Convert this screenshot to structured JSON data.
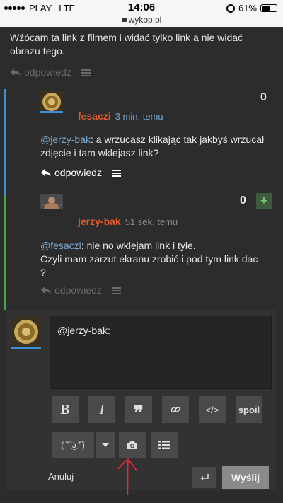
{
  "statusbar": {
    "carrier": "PLAY",
    "network": "LTE",
    "time": "14:06",
    "url": "wykop.pl",
    "battery": "61%"
  },
  "thread": {
    "top_text": "Wźócam ta link z filmem i widać tylko link a nie widać obrazu tego.",
    "top_reply_label": "odpowiedz"
  },
  "comments": [
    {
      "author": "fesaczi",
      "time": "3 min. temu",
      "score": "0",
      "mention": "@jerzy-bak",
      "text": ": a wrzucasz klikając tak jakbyś wrzucał zdjęcie i tam wklejasz link?",
      "reply_label": "odpowiedz",
      "bar_color": "#3b8fd8"
    },
    {
      "author": "jerzy-bak",
      "time": "51 sek. temu",
      "score": "0",
      "plus": "+",
      "mention": "@fesaczi",
      "text_line1": ": nie no wklejam link i tyle.",
      "text_line2": "Czyli mam zarzut ekranu zrobić i pod tym link dac",
      "text_line3": "?",
      "reply_label": "odpowiedz",
      "bar_color": "#3ea84a"
    }
  ],
  "editor": {
    "value": "@jerzy-bak:",
    "buttons": {
      "bold": "B",
      "italic": "I",
      "quote": "❞",
      "link": "link-icon",
      "code": "</>",
      "spoil": "spoil",
      "lenny": "( ͡° ͜ʖ ͡°)",
      "dropdown": "chevron-down-icon",
      "photo": "camera-icon",
      "list": "list-icon"
    },
    "cancel_label": "Anuluj",
    "send_label": "Wyślij"
  },
  "colors": {
    "accent_author": "#e35a2a",
    "mention": "#7aa8d0",
    "plus_green": "#6fcf6f",
    "annotation_arrow": "#e8283a"
  }
}
